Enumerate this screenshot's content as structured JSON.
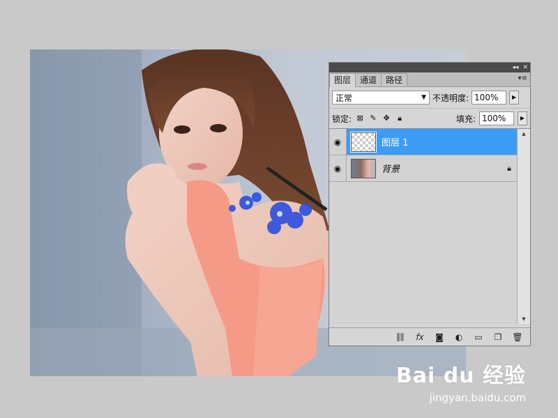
{
  "panel": {
    "tabs": [
      "图层",
      "通道",
      "路径"
    ],
    "blend_mode": "正常",
    "opacity_label": "不透明度:",
    "opacity_value": "100%",
    "lock_label": "锁定:",
    "fill_label": "填充:",
    "fill_value": "100%",
    "layers": [
      {
        "name": "图层 1",
        "selected": true
      },
      {
        "name": "背景",
        "selected": false
      }
    ]
  },
  "watermark": {
    "logo": "Bai du 经验",
    "url": "jingyan.baidu.com"
  },
  "icons": [
    "collapse-icon",
    "close-icon",
    "panel-menu-icon",
    "eye-icon",
    "lock-icon",
    "link-icon",
    "fx-icon",
    "mask-icon",
    "adjustment-icon",
    "folder-icon",
    "new-layer-icon",
    "trash-icon"
  ]
}
